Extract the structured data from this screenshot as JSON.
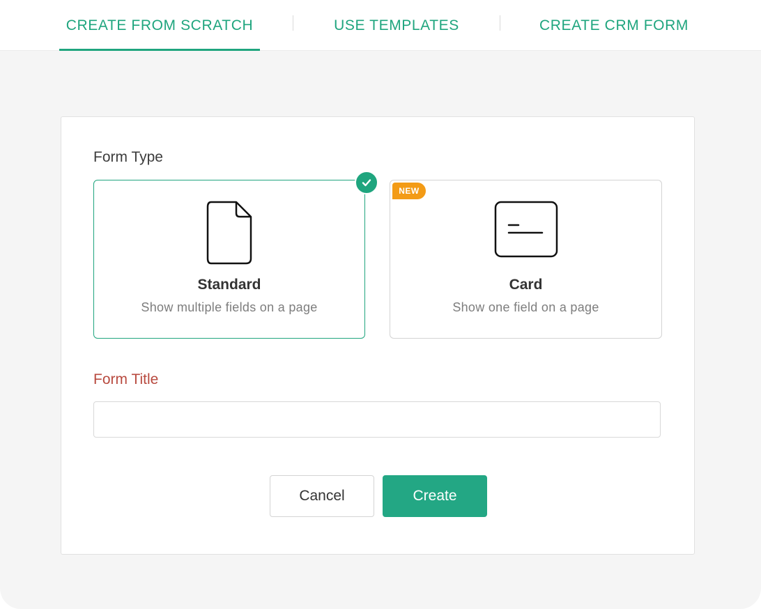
{
  "tabs": [
    {
      "label": "CREATE FROM SCRATCH",
      "active": true
    },
    {
      "label": "USE TEMPLATES",
      "active": false
    },
    {
      "label": "CREATE CRM FORM",
      "active": false
    }
  ],
  "form_type": {
    "label": "Form Type",
    "options": [
      {
        "title": "Standard",
        "description": "Show multiple fields on a page",
        "selected": true,
        "icon": "document-icon"
      },
      {
        "title": "Card",
        "description": "Show one field on a page",
        "selected": false,
        "badge": "NEW",
        "icon": "card-icon"
      }
    ]
  },
  "form_title": {
    "label": "Form Title",
    "value": "",
    "placeholder": ""
  },
  "actions": {
    "cancel_label": "Cancel",
    "create_label": "Create"
  },
  "colors": {
    "accent": "#1fa57e",
    "required_label": "#b84a3f",
    "new_badge": "#f39b16"
  }
}
